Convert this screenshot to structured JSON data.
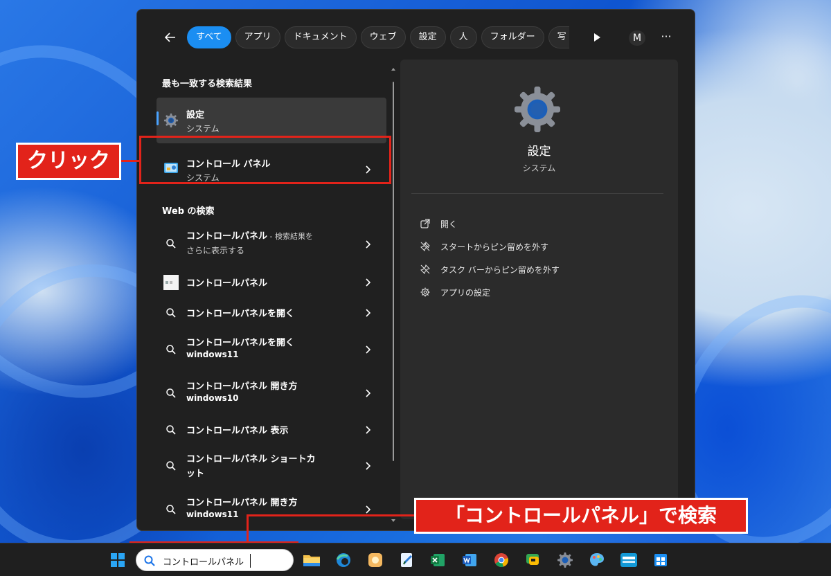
{
  "search_panel": {
    "tabs": [
      {
        "label": "すべて",
        "active": true
      },
      {
        "label": "アプリ"
      },
      {
        "label": "ドキュメント"
      },
      {
        "label": "ウェブ"
      },
      {
        "label": "設定"
      },
      {
        "label": "人"
      },
      {
        "label": "フォルダー"
      },
      {
        "label": "写"
      }
    ],
    "avatar_initial": "M",
    "more_label": "···",
    "best_match_title": "最も一致する検索結果",
    "best_match": {
      "title": "設定",
      "subtitle": "システム",
      "icon": "gear-icon"
    },
    "control_panel_result": {
      "title": "コントロール パネル",
      "subtitle": "システム",
      "icon": "control-panel-icon"
    },
    "web_section_title": "Web の検索",
    "web_results": [
      {
        "title": "コントロールパネル",
        "suffix": " - 検索結果を",
        "line2": "さらに表示する",
        "icon": "search-icon"
      },
      {
        "title": "コントロールパネル",
        "line2": "",
        "icon": "website-favicon-icon"
      },
      {
        "title": "コントロールパネルを開く",
        "line2": "",
        "icon": "search-icon"
      },
      {
        "title": "コントロールパネルを開く",
        "line2": "windows11",
        "icon": "search-icon"
      },
      {
        "title": "コントロールパネル 開き方",
        "line2": "windows10",
        "icon": "search-icon"
      },
      {
        "title": "コントロールパネル 表示",
        "line2": "",
        "icon": "search-icon"
      },
      {
        "title": "コントロールパネル ショートカ",
        "line2": "ット",
        "icon": "search-icon"
      },
      {
        "title": "コントロールパネル 開き方",
        "line2": "windows11",
        "icon": "search-icon"
      }
    ],
    "detail": {
      "title": "設定",
      "subtitle": "システム",
      "actions": [
        {
          "label": "開く",
          "icon": "open-external-icon"
        },
        {
          "label": "スタートからピン留めを外す",
          "icon": "unpin-icon"
        },
        {
          "label": "タスク バーからピン留めを外す",
          "icon": "unpin-icon"
        },
        {
          "label": "アプリの設定",
          "icon": "gear-icon"
        }
      ]
    }
  },
  "annotations": {
    "click_label": "クリック",
    "search_label": "「コントロールパネル」で検索",
    "color": "#e2231a"
  },
  "taskbar": {
    "search_value": "コントロールパネル",
    "apps": [
      "start-icon",
      "file-explorer-icon",
      "edge-icon",
      "photos-icon",
      "notepad-icon",
      "excel-icon",
      "word-icon",
      "chrome-icon",
      "chat-icon",
      "settings-icon",
      "paint-icon",
      "prime-video-icon",
      "store-icon"
    ]
  },
  "colors": {
    "accent": "#1b8ef2",
    "panel": "#202020",
    "pane": "#2b2b2b"
  }
}
